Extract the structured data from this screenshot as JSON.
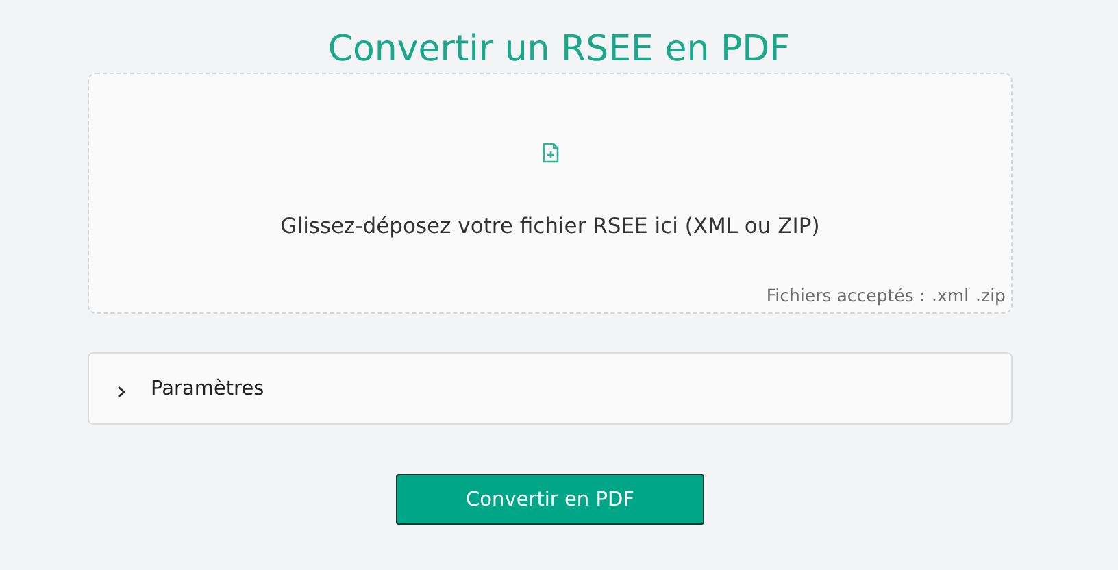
{
  "title": "Convertir un RSEE en PDF",
  "dropzone": {
    "prompt": "Glissez-déposez votre fichier RSEE ici (XML ou ZIP)",
    "accepted_label": "Fichiers acceptés :",
    "extensions": [
      ".xml",
      ".zip"
    ]
  },
  "settings": {
    "label": "Paramètres",
    "expanded": false
  },
  "convert_button": "Convertir en PDF"
}
